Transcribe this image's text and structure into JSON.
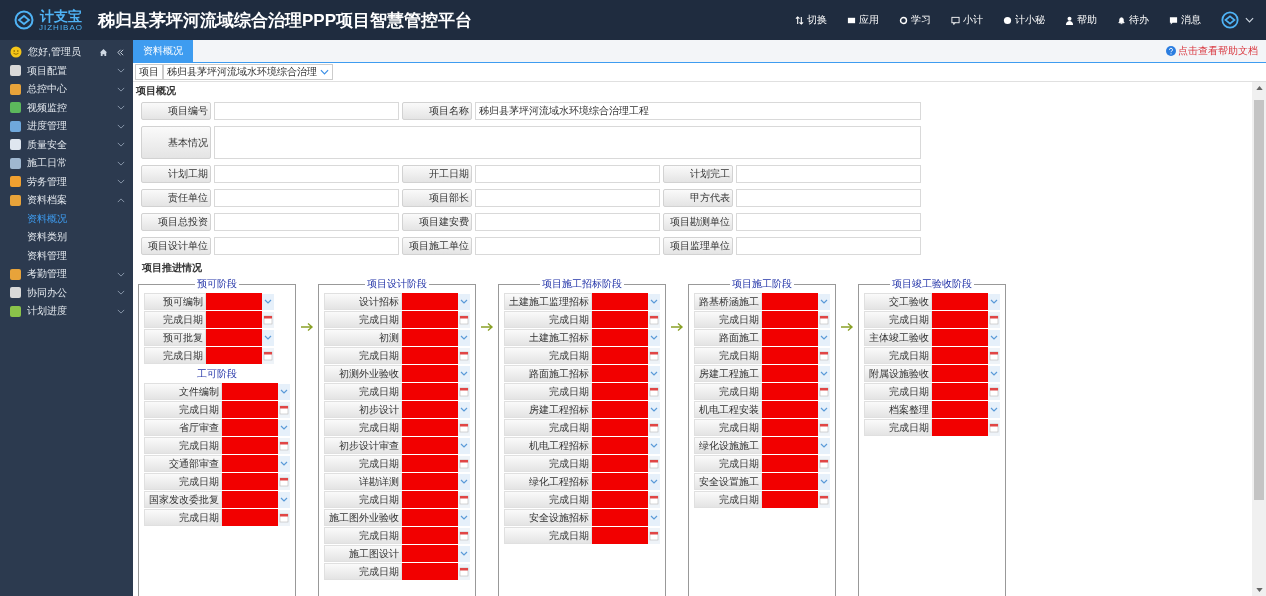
{
  "header": {
    "logo_text": "计支宝",
    "logo_subtext": "JIZHIBAO",
    "title": "秭归县茅坪河流域综合治理PPP项目智慧管控平台",
    "nav": [
      {
        "label": "切换"
      },
      {
        "label": "应用"
      },
      {
        "label": "学习"
      },
      {
        "label": "小计"
      },
      {
        "label": "计小秘"
      },
      {
        "label": "帮助"
      },
      {
        "label": "待办"
      },
      {
        "label": "消息"
      }
    ]
  },
  "sidebar": {
    "greeting": "您好,管理员",
    "items": [
      {
        "label": "项目配置",
        "expanded": false
      },
      {
        "label": "总控中心",
        "expanded": false
      },
      {
        "label": "视频监控",
        "expanded": false
      },
      {
        "label": "进度管理",
        "expanded": false
      },
      {
        "label": "质量安全",
        "expanded": false
      },
      {
        "label": "施工日常",
        "expanded": false
      },
      {
        "label": "劳务管理",
        "expanded": false
      },
      {
        "label": "资料档案",
        "expanded": true,
        "children": [
          {
            "label": "资料概况",
            "selected": true
          },
          {
            "label": "资料类别",
            "selected": false
          },
          {
            "label": "资料管理",
            "selected": false
          }
        ]
      },
      {
        "label": "考勤管理",
        "expanded": false
      },
      {
        "label": "协同办公",
        "expanded": false
      },
      {
        "label": "计划进度",
        "expanded": false
      }
    ]
  },
  "tabs": [
    {
      "label": "资料概况",
      "selected": true
    }
  ],
  "help_link": "点击查看帮助文档",
  "project_selector": {
    "label": "项目",
    "value": "秭归县茅坪河流域水环境综合治理"
  },
  "overview": {
    "title": "项目概况",
    "rows": [
      [
        {
          "label": "项目编号"
        },
        {
          "label": "项目名称",
          "value": "秭归县茅坪河流域水环境综合治理工程"
        }
      ],
      [
        {
          "label": "基本情况"
        }
      ],
      [
        {
          "label": "计划工期"
        },
        {
          "label": "开工日期"
        },
        {
          "label": "计划完工"
        }
      ],
      [
        {
          "label": "责任单位"
        },
        {
          "label": "项目部长"
        },
        {
          "label": "甲方代表"
        }
      ],
      [
        {
          "label": "项目总投资"
        },
        {
          "label": "项目建安费"
        },
        {
          "label": "项目勘测单位"
        }
      ],
      [
        {
          "label": "项目设计单位"
        },
        {
          "label": "项目施工单位"
        },
        {
          "label": "项目监理单位"
        }
      ]
    ]
  },
  "progress": {
    "title": "项目推进情况",
    "stages": [
      {
        "groups": [
          {
            "title": "预可阶段",
            "rows": [
              {
                "label": "预可编制",
                "kind": "select"
              },
              {
                "label": "完成日期",
                "kind": "date"
              },
              {
                "label": "预可批复",
                "kind": "select"
              },
              {
                "label": "完成日期",
                "kind": "date"
              }
            ]
          },
          {
            "title": "工可阶段",
            "rows": [
              {
                "label": "文件编制",
                "kind": "select"
              },
              {
                "label": "完成日期",
                "kind": "date"
              },
              {
                "label": "省厅审查",
                "kind": "select"
              },
              {
                "label": "完成日期",
                "kind": "date"
              },
              {
                "label": "交通部审查",
                "kind": "select"
              },
              {
                "label": "完成日期",
                "kind": "date"
              },
              {
                "label": "国家发改委批复",
                "kind": "select"
              },
              {
                "label": "完成日期",
                "kind": "date"
              }
            ]
          }
        ]
      },
      {
        "groups": [
          {
            "title": "项目设计阶段",
            "rows": [
              {
                "label": "设计招标",
                "kind": "select"
              },
              {
                "label": "完成日期",
                "kind": "date"
              },
              {
                "label": "初测",
                "kind": "select"
              },
              {
                "label": "完成日期",
                "kind": "date"
              },
              {
                "label": "初测外业验收",
                "kind": "select"
              },
              {
                "label": "完成日期",
                "kind": "date"
              },
              {
                "label": "初步设计",
                "kind": "select"
              },
              {
                "label": "完成日期",
                "kind": "date"
              },
              {
                "label": "初步设计审查",
                "kind": "select"
              },
              {
                "label": "完成日期",
                "kind": "date"
              },
              {
                "label": "详勘详测",
                "kind": "select"
              },
              {
                "label": "完成日期",
                "kind": "date"
              },
              {
                "label": "施工图外业验收",
                "kind": "select"
              },
              {
                "label": "完成日期",
                "kind": "date"
              },
              {
                "label": "施工图设计",
                "kind": "select"
              },
              {
                "label": "完成日期",
                "kind": "date"
              }
            ]
          }
        ]
      },
      {
        "groups": [
          {
            "title": "项目施工招标阶段",
            "rows": [
              {
                "label": "土建施工监理招标",
                "kind": "select"
              },
              {
                "label": "完成日期",
                "kind": "date"
              },
              {
                "label": "土建施工招标",
                "kind": "select"
              },
              {
                "label": "完成日期",
                "kind": "date"
              },
              {
                "label": "路面施工招标",
                "kind": "select"
              },
              {
                "label": "完成日期",
                "kind": "date"
              },
              {
                "label": "房建工程招标",
                "kind": "select"
              },
              {
                "label": "完成日期",
                "kind": "date"
              },
              {
                "label": "机电工程招标",
                "kind": "select"
              },
              {
                "label": "完成日期",
                "kind": "date"
              },
              {
                "label": "绿化工程招标",
                "kind": "select"
              },
              {
                "label": "完成日期",
                "kind": "date"
              },
              {
                "label": "安全设施招标",
                "kind": "select"
              },
              {
                "label": "完成日期",
                "kind": "date"
              }
            ]
          }
        ]
      },
      {
        "groups": [
          {
            "title": "项目施工阶段",
            "rows": [
              {
                "label": "路基桥涵施工",
                "kind": "select"
              },
              {
                "label": "完成日期",
                "kind": "date"
              },
              {
                "label": "路面施工",
                "kind": "select"
              },
              {
                "label": "完成日期",
                "kind": "date"
              },
              {
                "label": "房建工程施工",
                "kind": "select"
              },
              {
                "label": "完成日期",
                "kind": "date"
              },
              {
                "label": "机电工程安装",
                "kind": "select"
              },
              {
                "label": "完成日期",
                "kind": "date"
              },
              {
                "label": "绿化设施施工",
                "kind": "select"
              },
              {
                "label": "完成日期",
                "kind": "date"
              },
              {
                "label": "安全设置施工",
                "kind": "select"
              },
              {
                "label": "完成日期",
                "kind": "date"
              }
            ]
          }
        ]
      },
      {
        "groups": [
          {
            "title": "项目竣工验收阶段",
            "rows": [
              {
                "label": "交工验收",
                "kind": "select"
              },
              {
                "label": "完成日期",
                "kind": "date"
              },
              {
                "label": "主体竣工验收",
                "kind": "select"
              },
              {
                "label": "完成日期",
                "kind": "date"
              },
              {
                "label": "附属设施验收",
                "kind": "select"
              },
              {
                "label": "完成日期",
                "kind": "date"
              },
              {
                "label": "档案整理",
                "kind": "select"
              },
              {
                "label": "完成日期",
                "kind": "date"
              }
            ]
          }
        ]
      }
    ]
  }
}
